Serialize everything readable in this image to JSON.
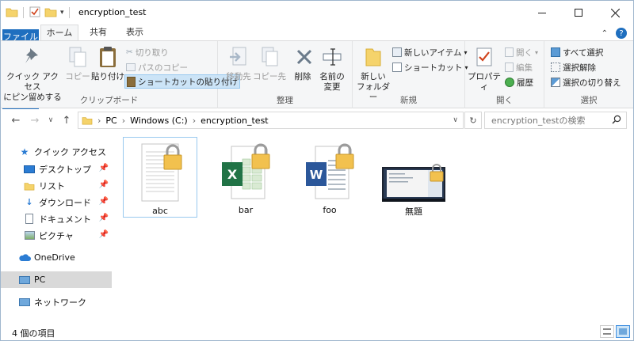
{
  "window": {
    "title": "encryption_test",
    "controls": [
      "minimize-icon",
      "maximize-icon",
      "close-icon"
    ]
  },
  "tabs": {
    "file": "ファイル",
    "home": "ホーム",
    "share": "共有",
    "view": "表示"
  },
  "ribbon": {
    "clipboard": {
      "label": "クリップボード",
      "pin_quick_access": [
        "クイック アクセス",
        "にピン留めする"
      ],
      "copy": "コピー",
      "paste": "貼り付け",
      "cut": "切り取り",
      "copy_path": "パスのコピー",
      "paste_shortcut": "ショートカットの貼り付け"
    },
    "organize": {
      "label": "整理",
      "move_to": "移動先",
      "copy_to": "コピー先",
      "delete": "削除",
      "rename": [
        "名前の",
        "変更"
      ]
    },
    "new": {
      "label": "新規",
      "new_folder": [
        "新しい",
        "フォルダー"
      ],
      "new_item": "新しいアイテム",
      "shortcut": "ショートカット"
    },
    "open": {
      "label": "開く",
      "properties": "プロパティ",
      "open": "開く",
      "edit": "編集",
      "history": "履歴"
    },
    "select": {
      "label": "選択",
      "select_all": "すべて選択",
      "select_none": "選択解除",
      "invert": "選択の切り替え"
    }
  },
  "address": {
    "path": [
      "PC",
      "Windows (C:)",
      "encryption_test"
    ],
    "search_placeholder": "encryption_testの検索"
  },
  "nav_pane": {
    "quick_access": "クイック アクセス",
    "items": [
      {
        "label": "デスクトップ",
        "icon": "desktop-icon",
        "pinned": true
      },
      {
        "label": "リスト",
        "icon": "folder-icon",
        "pinned": true
      },
      {
        "label": "ダウンロード",
        "icon": "download-icon",
        "pinned": true
      },
      {
        "label": "ドキュメント",
        "icon": "documents-icon",
        "pinned": true
      },
      {
        "label": "ピクチャ",
        "icon": "pictures-icon",
        "pinned": true
      }
    ],
    "onedrive": "OneDrive",
    "pc": "PC",
    "network": "ネットワーク"
  },
  "files": [
    {
      "name": "abc",
      "type": "text",
      "encrypted": true,
      "selected": true
    },
    {
      "name": "bar",
      "type": "excel",
      "encrypted": true,
      "selected": false
    },
    {
      "name": "foo",
      "type": "word",
      "encrypted": true,
      "selected": false
    },
    {
      "name": "無題",
      "type": "image",
      "encrypted": true,
      "selected": false
    }
  ],
  "status": {
    "count_text": "4 個の項目"
  },
  "colors": {
    "accent": "#1f6fbf",
    "excel": "#217346",
    "word": "#2b579a",
    "lock": "#f2c14e"
  }
}
